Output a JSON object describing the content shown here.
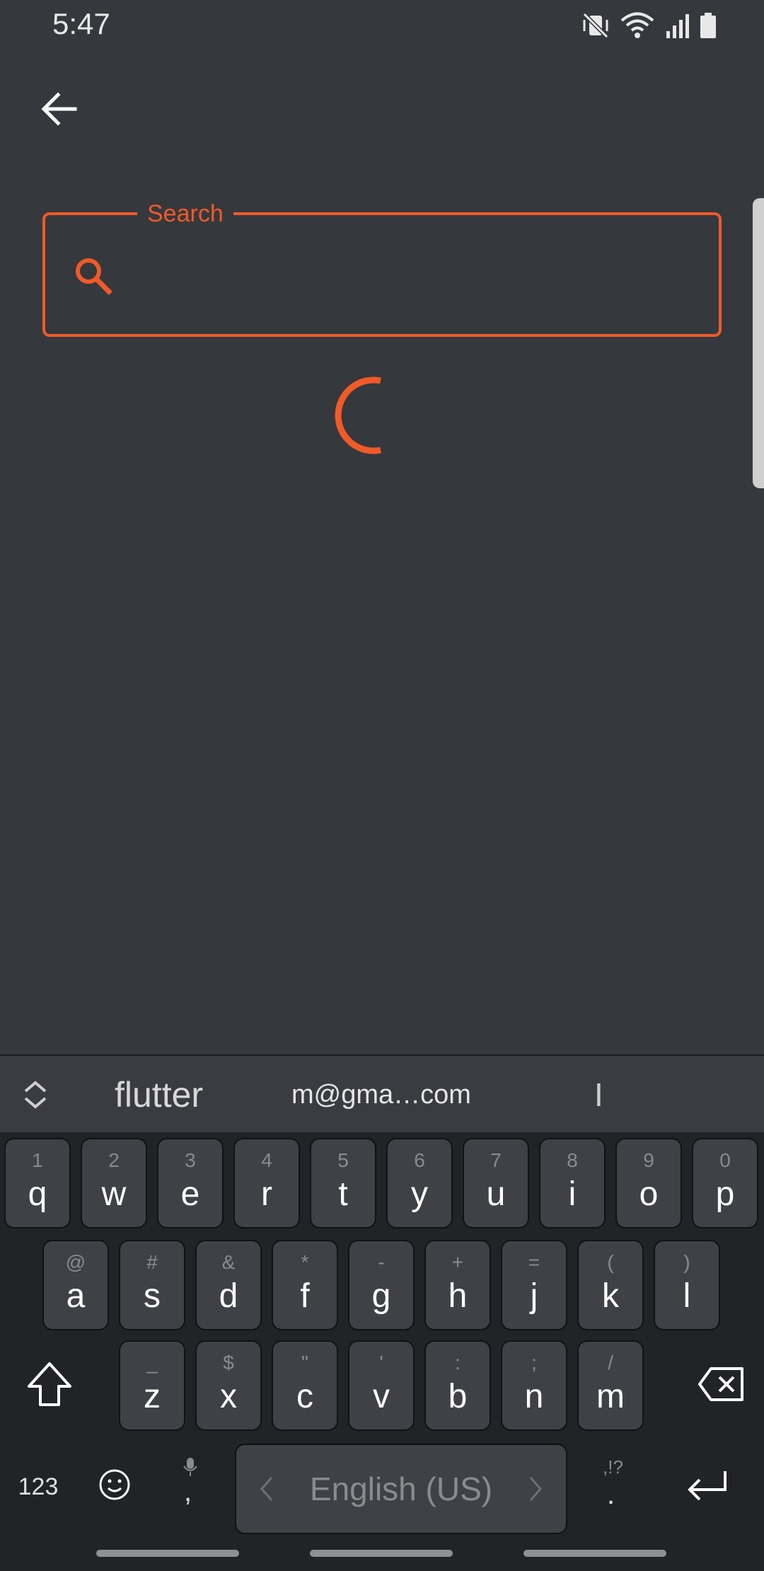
{
  "status_bar": {
    "time": "5:47",
    "icons": [
      "vibrate-off-icon",
      "wifi-icon",
      "signal-icon",
      "battery-icon"
    ]
  },
  "app_bar": {
    "back_icon": "arrow-left-icon"
  },
  "search": {
    "label": "Search",
    "value": "",
    "icon": "search-icon",
    "accent_color": "#f05a28"
  },
  "loading": {
    "icon": "spinner-icon",
    "color": "#f05a28"
  },
  "keyboard": {
    "suggestions": [
      "flutter",
      "m@gma…com",
      "I"
    ],
    "rows": [
      [
        {
          "hint": "1",
          "key": "q"
        },
        {
          "hint": "2",
          "key": "w"
        },
        {
          "hint": "3",
          "key": "e"
        },
        {
          "hint": "4",
          "key": "r"
        },
        {
          "hint": "5",
          "key": "t"
        },
        {
          "hint": "6",
          "key": "y"
        },
        {
          "hint": "7",
          "key": "u"
        },
        {
          "hint": "8",
          "key": "i"
        },
        {
          "hint": "9",
          "key": "o"
        },
        {
          "hint": "0",
          "key": "p"
        }
      ],
      [
        {
          "hint": "@",
          "key": "a"
        },
        {
          "hint": "#",
          "key": "s"
        },
        {
          "hint": "&",
          "key": "d"
        },
        {
          "hint": "*",
          "key": "f"
        },
        {
          "hint": "-",
          "key": "g"
        },
        {
          "hint": "+",
          "key": "h"
        },
        {
          "hint": "=",
          "key": "j"
        },
        {
          "hint": "(",
          "key": "k"
        },
        {
          "hint": ")",
          "key": "l"
        }
      ],
      [
        {
          "hint": "_",
          "key": "z"
        },
        {
          "hint": "$",
          "key": "x"
        },
        {
          "hint": "\"",
          "key": "c"
        },
        {
          "hint": "'",
          "key": "v"
        },
        {
          "hint": ":",
          "key": "b"
        },
        {
          "hint": ";",
          "key": "n"
        },
        {
          "hint": "/",
          "key": "m"
        }
      ]
    ],
    "numbers_label": "123",
    "comma": ",",
    "space_label": "English (US)",
    "punct_hint": ",!?",
    "period": "."
  }
}
